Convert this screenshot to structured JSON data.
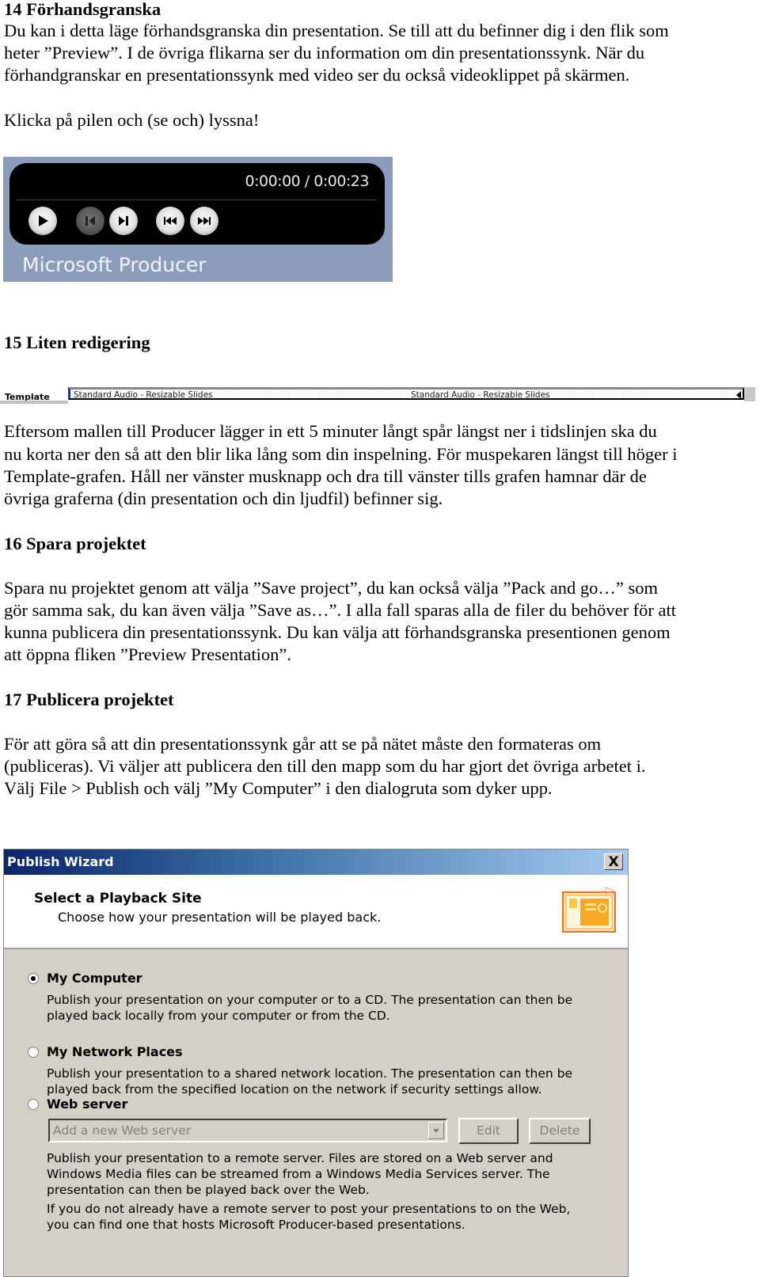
{
  "section14": {
    "heading": "14 Förhandsgranska",
    "lines": [
      "Du kan i detta läge förhandsgranska din presentation. Se till att du befinner dig i den flik som",
      "heter ”Preview”. I de övriga flikarna ser du information om din presentationssynk. När du",
      "förhandgranskar en presentationssynk med video ser du också videoklippet på skärmen."
    ],
    "instruction": "Klicka på pilen och (se och) lyssna!"
  },
  "player": {
    "time": "0:00:00 / 0:00:23",
    "brand": "Microsoft Producer",
    "buttons": [
      {
        "name": "play-icon",
        "enabled": true
      },
      {
        "name": "previous-icon",
        "enabled": false
      },
      {
        "name": "next-icon",
        "enabled": true
      },
      {
        "name": "rewind-icon",
        "enabled": true
      },
      {
        "name": "fast-forward-icon",
        "enabled": true
      }
    ]
  },
  "section15": {
    "heading": "15  Liten redigering",
    "track": {
      "label": "Template",
      "segments": [
        "Standard Audio - Resizable Slides",
        "Standard Audio - Resizable Slides"
      ]
    },
    "lines": [
      "Eftersom mallen till Producer lägger in ett 5 minuter långt spår längst ner i tidslinjen ska du",
      "nu korta ner den så att den blir lika lång som din inspelning. För muspekaren längst till höger i",
      "Template-grafen. Håll ner vänster musknapp och dra till vänster tills grafen hamnar där de",
      "övriga graferna (din presentation och din ljudfil) befinner sig."
    ]
  },
  "section16": {
    "heading": "16 Spara projektet",
    "lines": [
      "Spara nu projektet genom att välja ”Save project”, du kan också välja ”Pack and go…” som",
      "gör samma sak, du kan även välja ”Save as…”. I alla fall sparas alla de filer du behöver för att",
      "kunna publicera din presentationssynk. Du kan välja att förhandsgranska presentionen genom",
      "att öppna fliken ”Preview Presentation”."
    ]
  },
  "section17": {
    "heading": "17 Publicera projektet",
    "lines": [
      "För att göra så att din presentationssynk går att se på nätet måste den formateras om",
      "(publiceras). Vi väljer att publicera den till den mapp som du har gjort det övriga arbetet i.",
      "Välj File > Publish och välj ”My Computer” i den dialogruta som dyker upp."
    ]
  },
  "wizard": {
    "title": "Publish Wizard",
    "close": "X",
    "header_title": "Select a Playback Site",
    "header_subtitle": "Choose how your presentation will be played back.",
    "options": [
      {
        "label": "My Computer",
        "selected": true,
        "desc": [
          "Publish your presentation on your computer or to a CD. The presentation can then be",
          "played back locally from your computer or from the CD."
        ]
      },
      {
        "label": "My Network Places",
        "selected": false,
        "desc": [
          "Publish your presentation to a shared network location. The presentation can then be",
          "played back from the specified location on the network if security settings allow."
        ]
      },
      {
        "label": "Web server",
        "selected": false,
        "desc": [
          "Publish your presentation to a remote server. Files are stored on a Web server and",
          "Windows Media files can be streamed from a Windows Media Services server. The",
          "presentation can then be played back over the Web.",
          "If you do not already have a remote server to post your presentations to on the Web,",
          "you can find one that hosts Microsoft Producer-based presentations."
        ]
      }
    ],
    "server_combo": "Add a new Web server",
    "edit_button": "Edit",
    "delete_button": "Delete"
  }
}
